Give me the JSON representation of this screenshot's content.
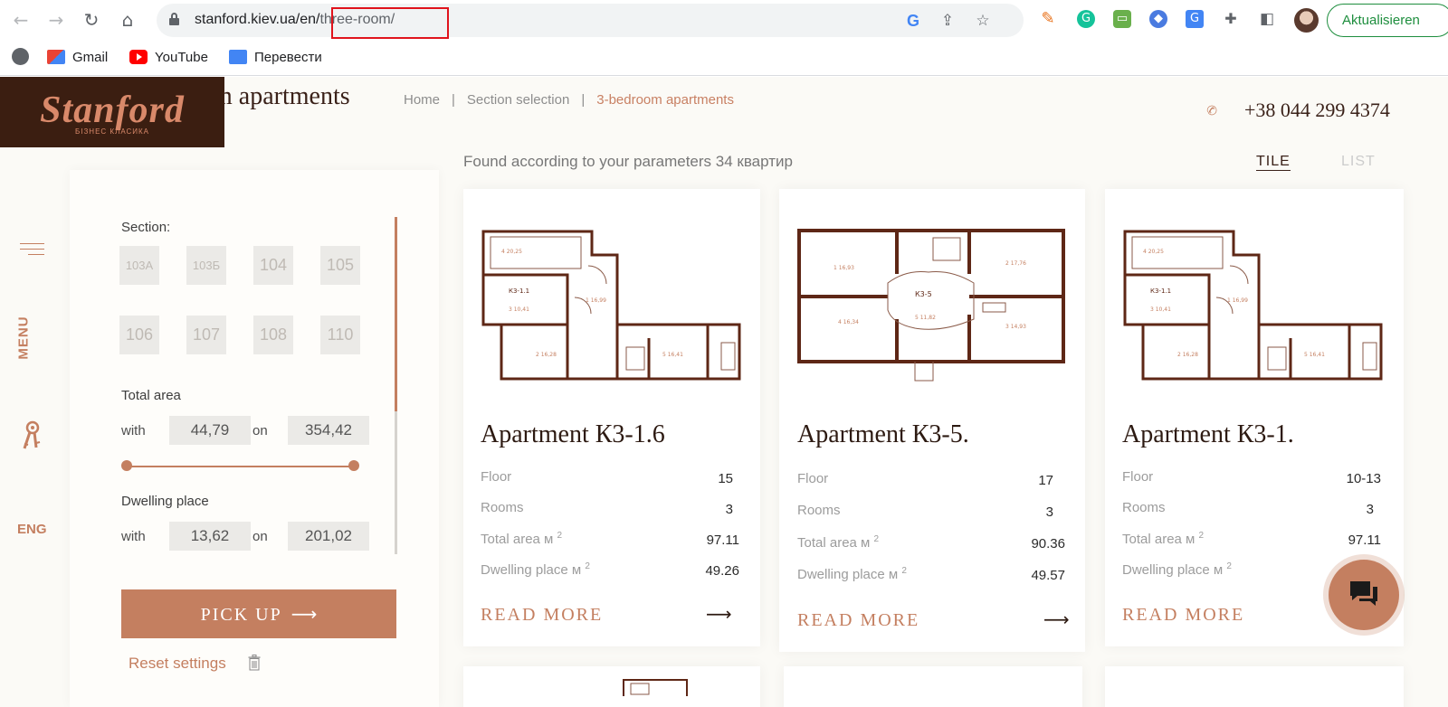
{
  "browser": {
    "url_host": "stanford.kiev.ua/en/",
    "url_path": "three-room/",
    "update_label": "Aktualisieren",
    "bookmarks": [
      {
        "label": "Gmail",
        "icon": "gmail-icon"
      },
      {
        "label": "YouTube",
        "icon": "youtube-icon"
      },
      {
        "label": "Перевести",
        "icon": "google-translate-icon"
      }
    ]
  },
  "header": {
    "title": "m apartments",
    "logo": "Stanford",
    "logo_sub": "БІЗНЕС КЛАСИКА",
    "breadcrumb": [
      "Home",
      "Section selection",
      "3-bedroom apartments"
    ],
    "phone": "+38 044 299 4374"
  },
  "sidebar": {
    "menu_label": "MENU",
    "lang": "ENG"
  },
  "filter": {
    "section_label": "Section:",
    "sections": [
      "103А",
      "103Б",
      "104",
      "105",
      "106",
      "107",
      "108",
      "110"
    ],
    "total_area_label": "Total area",
    "dwelling_label": "Dwelling place",
    "with_label": "with",
    "on_label": "on",
    "total_area_min": "44,79",
    "total_area_max": "354,42",
    "dwelling_min": "13,62",
    "dwelling_max": "201,02",
    "pickup_label": "PICK UP",
    "reset_label": "Reset settings"
  },
  "results": {
    "found_text": "Found according to your parameters 34 квартир",
    "view_tile": "TILE",
    "view_list": "LIST",
    "labels": {
      "floor": "Floor",
      "rooms": "Rooms",
      "total_area": "Total area м",
      "dwelling": "Dwelling place м",
      "sup": "2",
      "read_more": "READ MORE"
    },
    "cards": [
      {
        "title": "Apartment К3-1.6",
        "floor": "15",
        "rooms": "3",
        "total_area": "97.11",
        "dwelling": "49.26",
        "plan_label": "К3-1.1"
      },
      {
        "title": "Apartment К3-5.",
        "floor": "17",
        "rooms": "3",
        "total_area": "90.36",
        "dwelling": "49.57",
        "plan_label": "К3-5"
      },
      {
        "title": "Apartment К3-1.",
        "floor": "10-13",
        "rooms": "3",
        "total_area": "97.11",
        "dwelling": "",
        "plan_label": "К3-1.1"
      }
    ]
  },
  "colors": {
    "accent": "#c47f60",
    "logo_bg": "#3b1e11",
    "page_bg": "#fbfaf6"
  }
}
